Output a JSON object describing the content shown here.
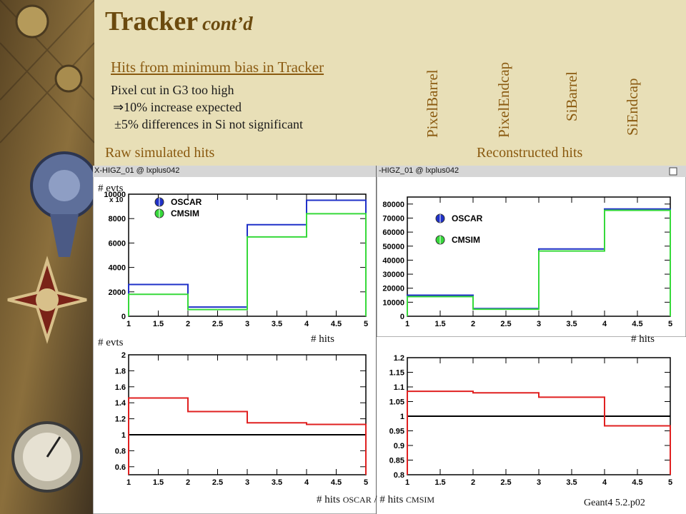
{
  "slide": {
    "title": "Tracker",
    "title_suffix": "cont’d",
    "subtitle_link": "Hits from minimum bias in Tracker",
    "lines": [
      "Pixel cut in G3 too high",
      "⇒10% increase expected",
      "±5% differences in Si not significant"
    ],
    "left_heading": "Raw simulated hits",
    "right_heading": "Reconstructed hits",
    "footer": "Geant4 5.2.p02",
    "ratio_label_prefix": "# hits ",
    "ratio_label_oscar": "OSCAR",
    "ratio_label_mid": " / # hits ",
    "ratio_label_cmsim": "CMSIM"
  },
  "detector_labels": [
    "PixelBarrel",
    "PixelEndcap",
    "SiBarrel",
    "SiEndcap"
  ],
  "windows": [
    {
      "title": "HIGZ_01 @ lxplus042",
      "window_icon": "x-window-icon",
      "close_icon": "close-box-icon"
    },
    {
      "title": "HIGZ_01 @ lxplus042",
      "window_icon": "x-window-icon",
      "close_icon": "close-box-icon"
    }
  ],
  "colors": {
    "oscar": "#1f30c8",
    "cmsim": "#36d93a",
    "ratio": "#e02020",
    "unity": "#000000",
    "title": "#6b4a0e",
    "accent": "#8a5a10"
  },
  "chart_data": [
    {
      "type": "step",
      "panel": "raw-hits",
      "ylabel": "# evts",
      "xlabel": "# hits",
      "y_multiplier": "x 10",
      "xlim": [
        1,
        5
      ],
      "ylim": [
        0,
        10000
      ],
      "xticks": [
        "1",
        "1.5",
        "2",
        "2.5",
        "3",
        "3.5",
        "4",
        "4.5",
        "5"
      ],
      "yticks": [
        "0",
        "2000",
        "4000",
        "6000",
        "8000",
        "10000"
      ],
      "bins": [
        1,
        2,
        3,
        4,
        5
      ],
      "series": [
        {
          "name": "OSCAR",
          "values": [
            2600,
            750,
            7500,
            9500
          ]
        },
        {
          "name": "CMSIM",
          "values": [
            1800,
            550,
            6500,
            8400
          ]
        }
      ]
    },
    {
      "type": "step",
      "panel": "reco-hits",
      "xlabel": "# hits",
      "xlim": [
        1,
        5
      ],
      "ylim": [
        0,
        85000
      ],
      "xticks": [
        "1",
        "1.5",
        "2",
        "2.5",
        "3",
        "3.5",
        "4",
        "4.5",
        "5"
      ],
      "yticks": [
        "0",
        "10000",
        "20000",
        "30000",
        "40000",
        "50000",
        "60000",
        "70000",
        "80000"
      ],
      "bins": [
        1,
        2,
        3,
        4,
        5
      ],
      "series": [
        {
          "name": "OSCAR",
          "values": [
            15000,
            5500,
            48000,
            76500
          ]
        },
        {
          "name": "CMSIM",
          "values": [
            14000,
            5000,
            46500,
            75500
          ]
        }
      ]
    },
    {
      "type": "step",
      "panel": "raw-ratio",
      "ylabel": "# evts",
      "xlim": [
        1,
        5
      ],
      "ylim": [
        0.5,
        2
      ],
      "xticks": [
        "1",
        "1.5",
        "2",
        "2.5",
        "3",
        "3.5",
        "4",
        "4.5",
        "5"
      ],
      "yticks": [
        "0.6",
        "0.8",
        "1",
        "1.2",
        "1.4",
        "1.6",
        "1.8",
        "2"
      ],
      "bins": [
        1,
        2,
        3,
        4,
        5
      ],
      "reference": 1,
      "series": [
        {
          "values": [
            1.46,
            1.29,
            1.15,
            1.13
          ]
        }
      ]
    },
    {
      "type": "step",
      "panel": "reco-ratio",
      "xlim": [
        1,
        5
      ],
      "ylim": [
        0.8,
        1.2
      ],
      "xticks": [
        "1",
        "1.5",
        "2",
        "2.5",
        "3",
        "3.5",
        "4",
        "4.5",
        "5"
      ],
      "yticks": [
        "0.8",
        "0.85",
        "0.9",
        "0.95",
        "1",
        "1.05",
        "1.1",
        "1.15",
        "1.2"
      ],
      "bins": [
        1,
        2,
        3,
        4,
        5
      ],
      "reference": 1,
      "series": [
        {
          "values": [
            1.085,
            1.08,
            1.065,
            0.967
          ]
        }
      ]
    }
  ]
}
